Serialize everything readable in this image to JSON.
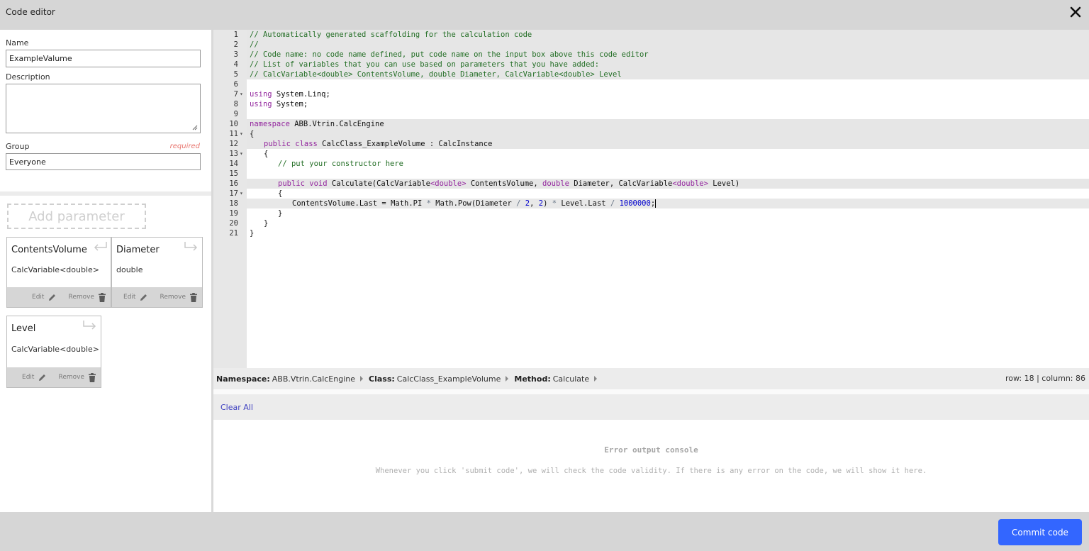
{
  "window": {
    "title": "Code editor",
    "close_icon": "close-icon"
  },
  "form": {
    "name_label": "Name",
    "name_value": "ExampleValume",
    "description_label": "Description",
    "description_value": "",
    "group_label": "Group",
    "group_required": "required",
    "group_value": "Everyone"
  },
  "parameters": {
    "add_label": "Add parameter",
    "edit_label": "Edit",
    "remove_label": "Remove",
    "items": [
      {
        "name": "ContentsVolume",
        "type": "CalcVariable<double>",
        "direction": "output"
      },
      {
        "name": "Diameter",
        "type": "double",
        "direction": "input"
      },
      {
        "name": "Level",
        "type": "CalcVariable<double>",
        "direction": "input"
      }
    ]
  },
  "editor": {
    "lines": [
      {
        "n": "1",
        "fold": "",
        "indent": 0,
        "hl": true,
        "tokens": [
          [
            "c",
            "// Automatically generated scaffolding for the calculation code"
          ]
        ]
      },
      {
        "n": "2",
        "fold": "",
        "indent": 0,
        "hl": true,
        "tokens": [
          [
            "c",
            "//"
          ]
        ]
      },
      {
        "n": "3",
        "fold": "",
        "indent": 0,
        "hl": true,
        "tokens": [
          [
            "c",
            "// Code name: no code name defined, put code name on the input box above this code editor"
          ]
        ]
      },
      {
        "n": "4",
        "fold": "",
        "indent": 0,
        "hl": true,
        "tokens": [
          [
            "c",
            "// List of variables that you can use based on parameters that you have added:"
          ]
        ]
      },
      {
        "n": "5",
        "fold": "",
        "indent": 0,
        "hl": true,
        "tokens": [
          [
            "c",
            "// CalcVariable<double> ContentsVolume, double Diameter, CalcVariable<double> Level"
          ]
        ]
      },
      {
        "n": "6",
        "fold": "",
        "indent": 0,
        "hl": false,
        "tokens": []
      },
      {
        "n": "7",
        "fold": "▾",
        "indent": 0,
        "hl": false,
        "tokens": [
          [
            "k",
            "using"
          ],
          [
            "t",
            " System.Linq;"
          ]
        ]
      },
      {
        "n": "8",
        "fold": "",
        "indent": 0,
        "hl": false,
        "tokens": [
          [
            "k",
            "using"
          ],
          [
            "t",
            " System;"
          ]
        ]
      },
      {
        "n": "9",
        "fold": "",
        "indent": 0,
        "hl": false,
        "tokens": []
      },
      {
        "n": "10",
        "fold": "",
        "indent": 0,
        "hl": true,
        "tokens": [
          [
            "k",
            "namespace"
          ],
          [
            "t",
            " ABB.Vtrin.CalcEngine"
          ]
        ]
      },
      {
        "n": "11",
        "fold": "▾",
        "indent": 0,
        "hl": true,
        "tokens": [
          [
            "t",
            "{"
          ]
        ]
      },
      {
        "n": "12",
        "fold": "",
        "indent": 1,
        "hl": true,
        "tokens": [
          [
            "k",
            "public class"
          ],
          [
            "t",
            " CalcClass_ExampleVolume : CalcInstance"
          ]
        ]
      },
      {
        "n": "13",
        "fold": "▾",
        "indent": 1,
        "hl": false,
        "tokens": [
          [
            "t",
            "{"
          ]
        ]
      },
      {
        "n": "14",
        "fold": "",
        "indent": 2,
        "hl": false,
        "tokens": [
          [
            "c",
            "// put your constructor here"
          ]
        ]
      },
      {
        "n": "15",
        "fold": "",
        "indent": 0,
        "hl": false,
        "tokens": []
      },
      {
        "n": "16",
        "fold": "",
        "indent": 2,
        "hl": true,
        "tokens": [
          [
            "k",
            "public void"
          ],
          [
            "t",
            " Calculate(CalcVariable"
          ],
          [
            "k",
            "<double>"
          ],
          [
            "t",
            " ContentsVolume, "
          ],
          [
            "k",
            "double"
          ],
          [
            "t",
            " Diameter, CalcVariable"
          ],
          [
            "k",
            "<double>"
          ],
          [
            "t",
            " Level)"
          ]
        ]
      },
      {
        "n": "17",
        "fold": "▾",
        "indent": 2,
        "hl": false,
        "tokens": [
          [
            "t",
            "{"
          ]
        ]
      },
      {
        "n": "18",
        "fold": "",
        "indent": 3,
        "hl": true,
        "cur": true,
        "tokens": [
          [
            "t",
            "ContentsVolume.Last = Math.PI "
          ],
          [
            "o",
            "*"
          ],
          [
            "t",
            " Math.Pow(Diameter "
          ],
          [
            "o",
            "/"
          ],
          [
            "t",
            " "
          ],
          [
            "n",
            "2"
          ],
          [
            "t",
            ", "
          ],
          [
            "n",
            "2"
          ],
          [
            "t",
            ") "
          ],
          [
            "o",
            "*"
          ],
          [
            "t",
            " Level.Last "
          ],
          [
            "o",
            "/"
          ],
          [
            "t",
            " "
          ],
          [
            "n",
            "1000000"
          ],
          [
            "t",
            ";"
          ]
        ]
      },
      {
        "n": "19",
        "fold": "",
        "indent": 2,
        "hl": false,
        "tokens": [
          [
            "t",
            "}"
          ]
        ]
      },
      {
        "n": "20",
        "fold": "",
        "indent": 1,
        "hl": false,
        "tokens": [
          [
            "t",
            "}"
          ]
        ]
      },
      {
        "n": "21",
        "fold": "",
        "indent": 0,
        "hl": false,
        "tokens": [
          [
            "t",
            "}"
          ]
        ]
      }
    ]
  },
  "statusbar": {
    "namespace_label": "Namespace:",
    "namespace_value": "ABB.Vtrin.CalcEngine",
    "class_label": "Class:",
    "class_value": "CalcClass_ExampleVolume",
    "method_label": "Method:",
    "method_value": "Calculate",
    "position": "row: 18 | column: 86"
  },
  "console": {
    "clear_label": "Clear All",
    "title": "Error output console",
    "description": "Whenever you click 'submit code', we will check the code validity. If there is any error on the code, we will show it here."
  },
  "footer": {
    "commit_label": "Commit code"
  },
  "colors": {
    "accent": "#3366ff",
    "comment": "#236e25",
    "keyword": "#93269e",
    "number": "#0000cd",
    "required": "#e8736c"
  }
}
